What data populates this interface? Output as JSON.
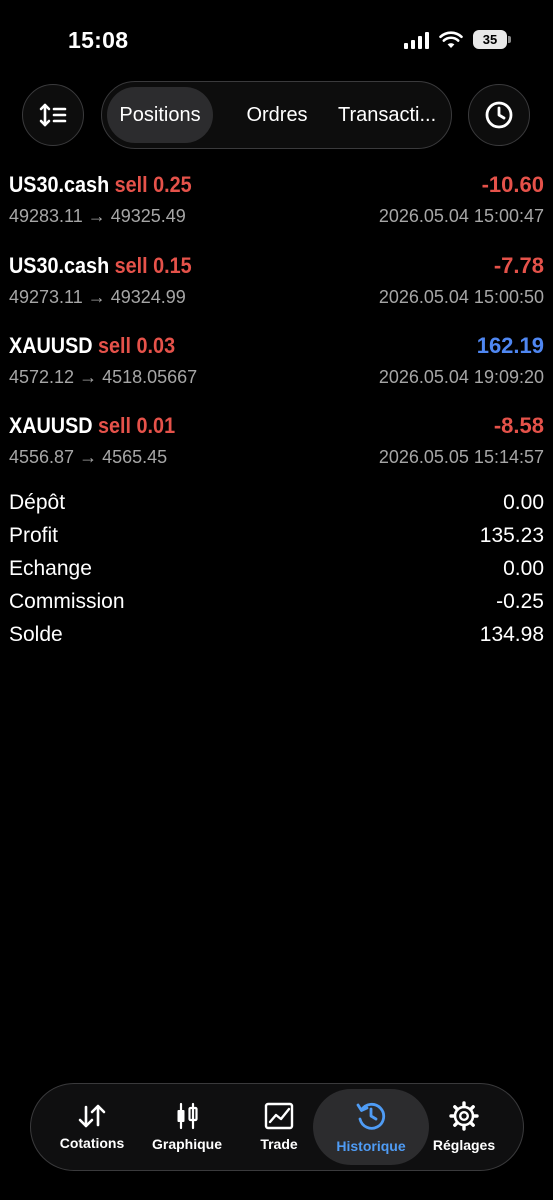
{
  "status": {
    "time": "15:08",
    "battery": "35"
  },
  "tabs": {
    "positions": "Positions",
    "orders": "Ordres",
    "transactions": "Transacti..."
  },
  "trades": [
    {
      "symbol": "US30.cash",
      "side": "sell 0.25",
      "profit": "-10.60",
      "prices": "49283.11 → 49325.49",
      "date": "2026.05.04 15:00:47"
    },
    {
      "symbol": "US30.cash",
      "side": "sell 0.15",
      "profit": "-7.78",
      "prices": "49273.11 → 49324.99",
      "date": "2026.05.04 15:00:50"
    },
    {
      "symbol": "XAUUSD",
      "side": "sell 0.03",
      "profit": "162.19",
      "prices": "4572.12 → 4518.05667",
      "date": "2026.05.04 19:09:20"
    },
    {
      "symbol": "XAUUSD",
      "side": "sell 0.01",
      "profit": "-8.58",
      "prices": "4556.87 → 4565.45",
      "date": "2026.05.05 15:14:57"
    }
  ],
  "summary": [
    {
      "label": "Dépôt",
      "value": "0.00"
    },
    {
      "label": "Profit",
      "value": "135.23"
    },
    {
      "label": "Echange",
      "value": "0.00"
    },
    {
      "label": "Commission",
      "value": "-0.25"
    },
    {
      "label": "Solde",
      "value": "134.98"
    }
  ],
  "nav": {
    "quotes": "Cotations",
    "chart": "Graphique",
    "trade": "Trade",
    "history": "Historique",
    "settings": "Réglages"
  },
  "colors": {
    "loss": "#e5524a",
    "gain": "#4f87f2",
    "active": "#4f9cf5"
  }
}
